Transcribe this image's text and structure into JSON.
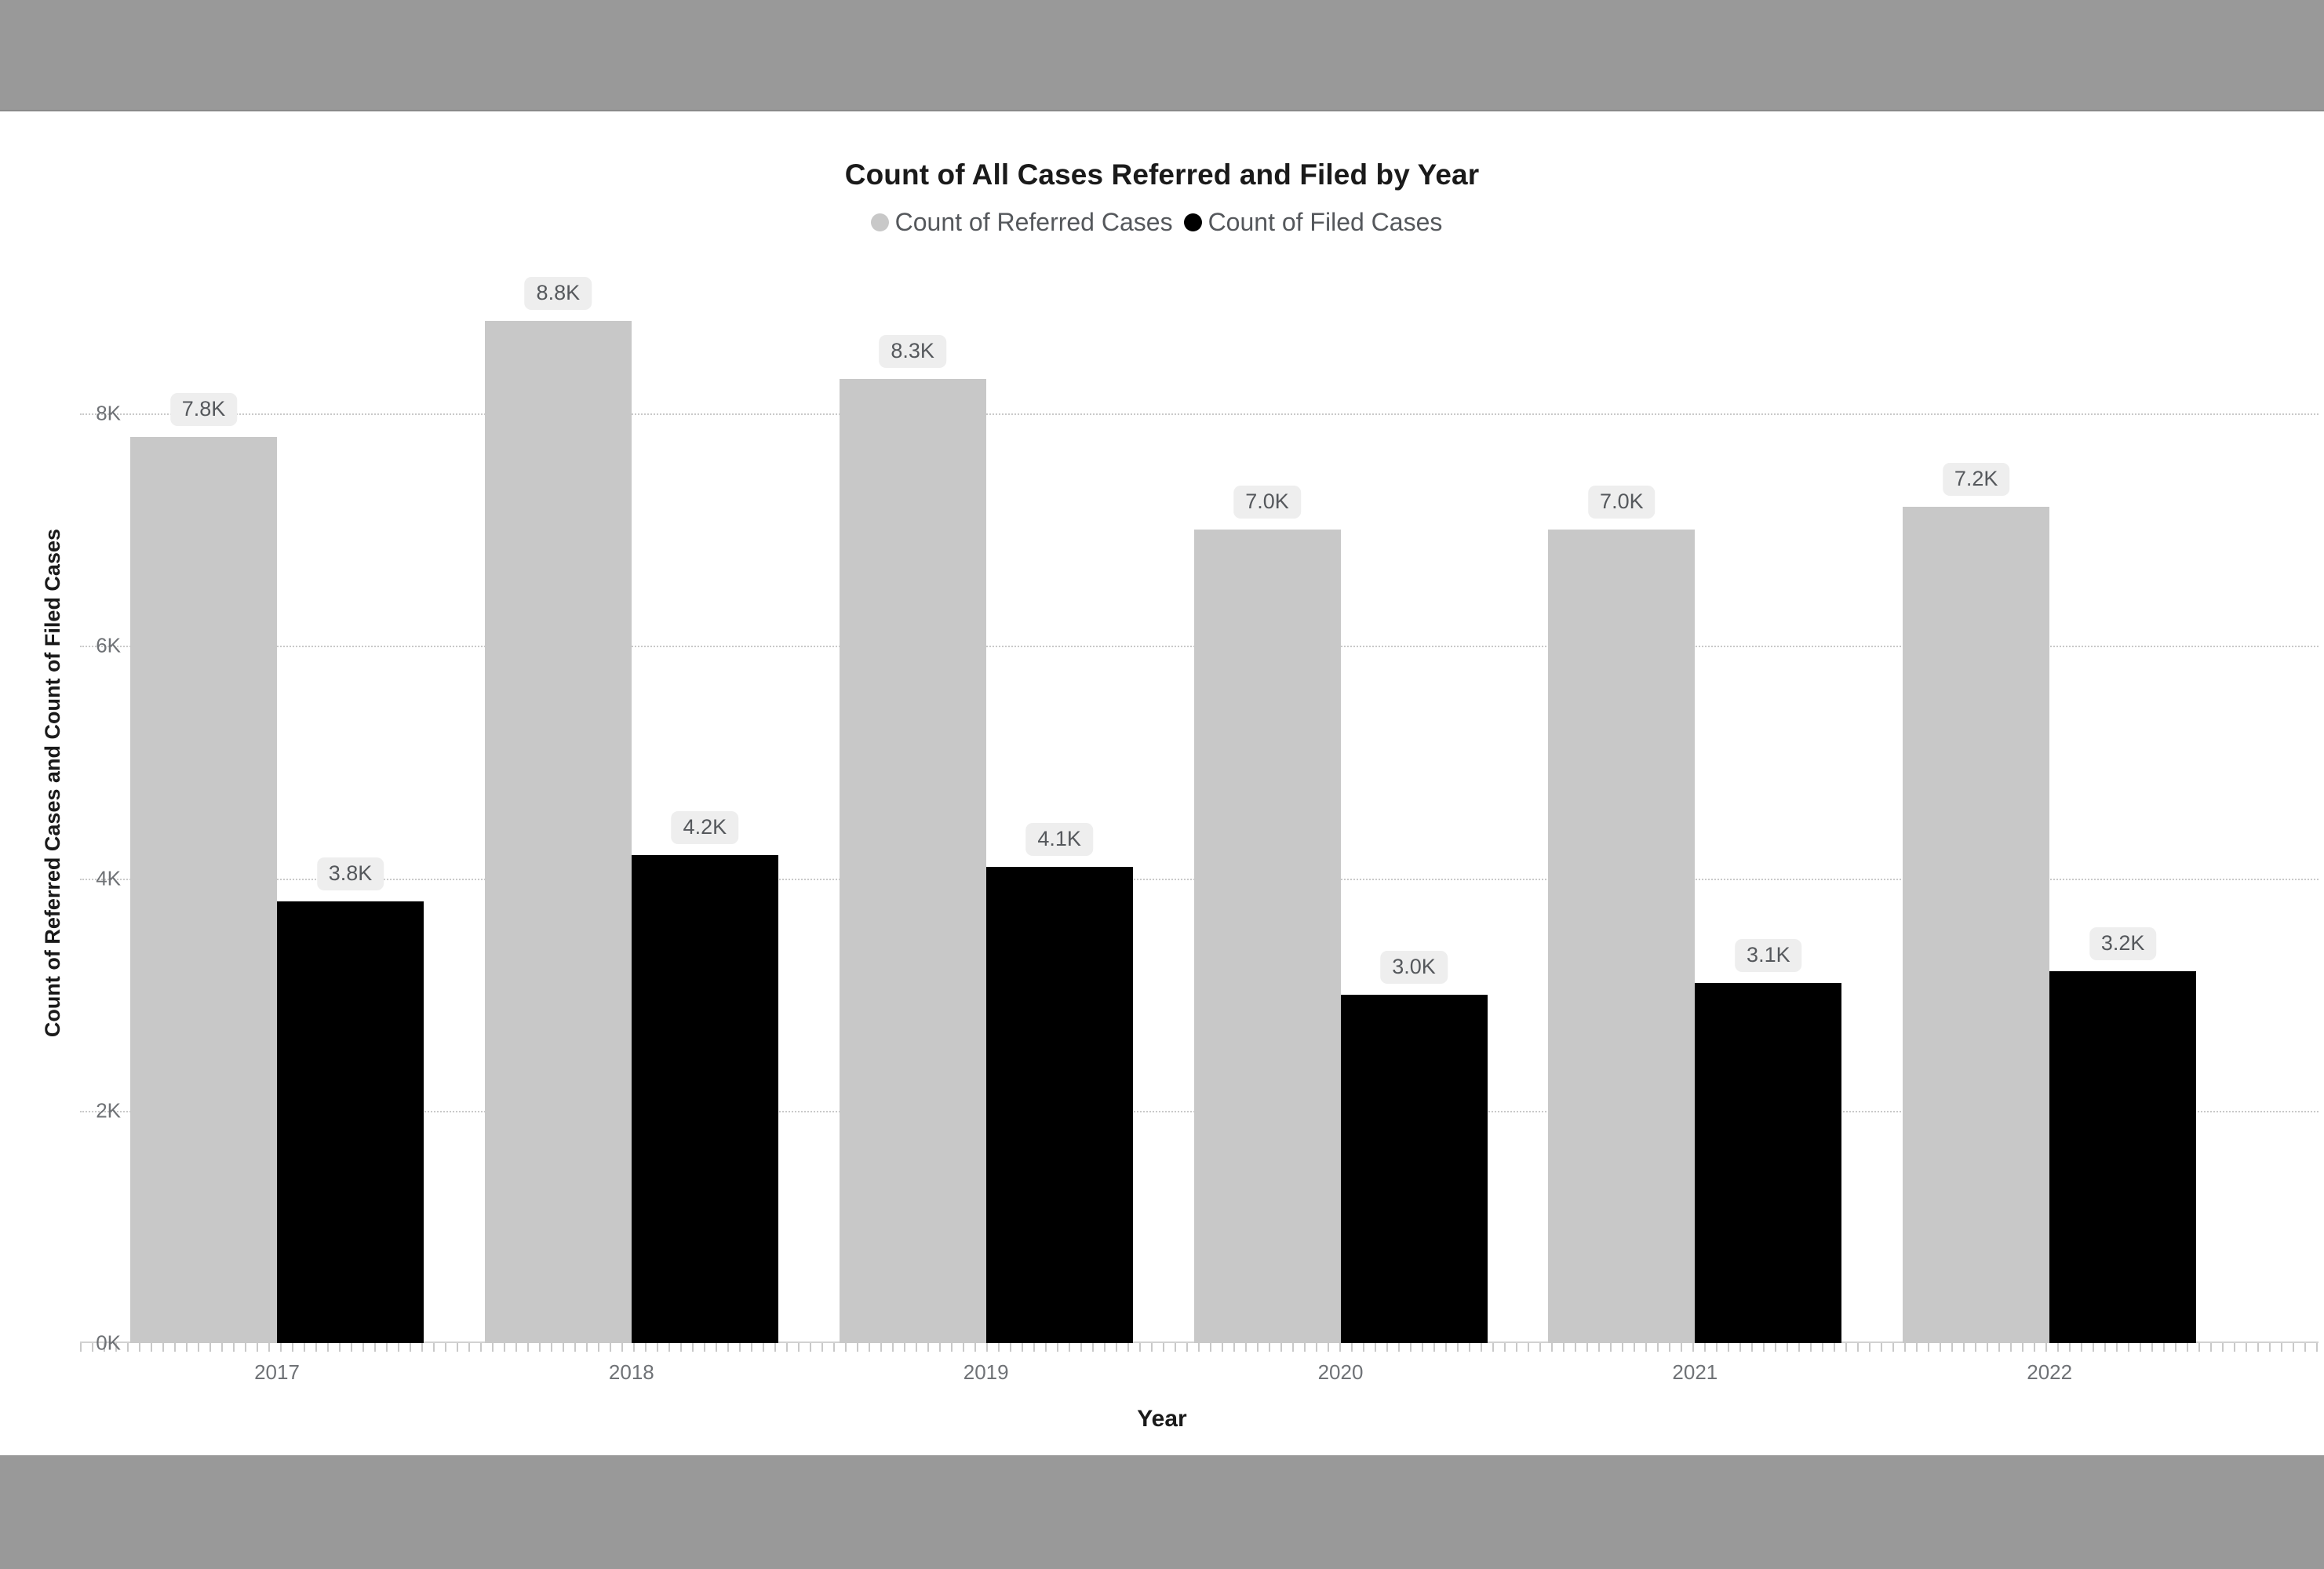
{
  "chrome": {
    "top_band_color": "#999999",
    "bottom_band_color": "#999999"
  },
  "chart_data": {
    "type": "bar",
    "title": "Count of All Cases Referred and Filed by Year",
    "xlabel": "Year",
    "ylabel": "Count of Referred Cases and Count of Filed Cases",
    "categories": [
      "2017",
      "2018",
      "2019",
      "2020",
      "2021",
      "2022"
    ],
    "series": [
      {
        "name": "Count of Referred Cases",
        "color": "#c8c8c8",
        "values": [
          7800,
          8800,
          8300,
          7000,
          7000,
          7200
        ],
        "labels": [
          "7.8K",
          "8.8K",
          "8.3K",
          "7.0K",
          "7.0K",
          "7.2K"
        ]
      },
      {
        "name": "Count of Filed Cases",
        "color": "#000000",
        "values": [
          3800,
          4200,
          4100,
          3000,
          3100,
          3200
        ],
        "labels": [
          "3.8K",
          "4.2K",
          "4.1K",
          "3.0K",
          "3.1K",
          "3.2K"
        ]
      }
    ],
    "ylim": [
      0,
      9000
    ],
    "yticks": [
      0,
      2000,
      4000,
      6000,
      8000
    ],
    "ytick_labels": [
      "0K",
      "2K",
      "4K",
      "6K",
      "8K"
    ],
    "grid": true,
    "grid_style": "dotted",
    "legend_position": "top-center",
    "label_background": "#eeeeee"
  }
}
